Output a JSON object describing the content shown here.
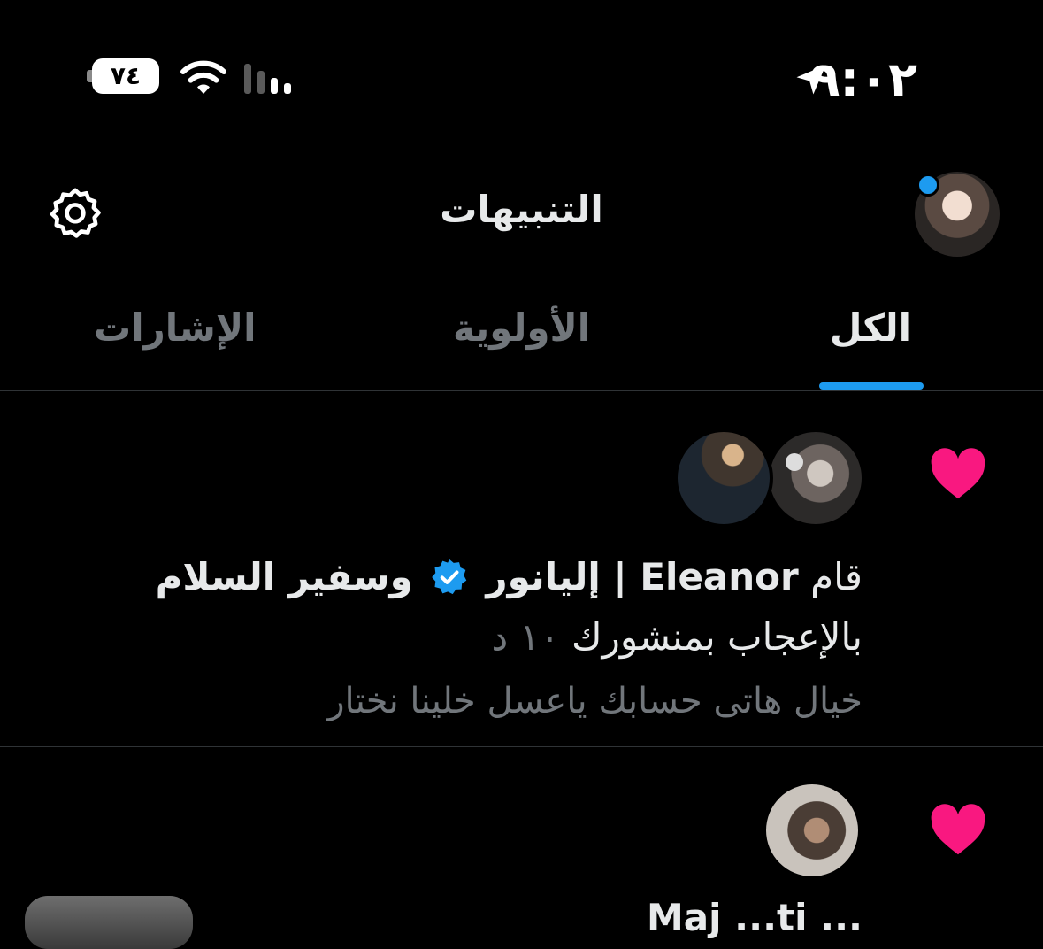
{
  "status_bar": {
    "time": "٩:٠٢",
    "battery": "٧٤",
    "icons": [
      "location-arrow-icon",
      "wifi-icon",
      "signal-icon",
      "battery-icon"
    ]
  },
  "header": {
    "title": "التنبيهات",
    "icons": [
      "gear-icon"
    ]
  },
  "tabs": [
    {
      "label": "الكل",
      "active": true
    },
    {
      "label": "الأولوية",
      "active": false
    },
    {
      "label": "الإشارات",
      "active": false
    }
  ],
  "notifications": [
    {
      "icon": "heart-icon",
      "prefix": "قام",
      "user1": "Eleanor | إليانور",
      "connector": "وسفير السلام",
      "action": "بالإعجاب بمنشورك",
      "time": "١٠ د",
      "preview": "خيال هاتى حسابك ياعسل  خلينا نختار"
    },
    {
      "icon": "heart-icon",
      "partial_text": "... Maj ...ti"
    }
  ],
  "colors": {
    "accent": "#1d9bf0",
    "heart": "#f91880",
    "background": "#000000",
    "muted": "#71767b"
  }
}
